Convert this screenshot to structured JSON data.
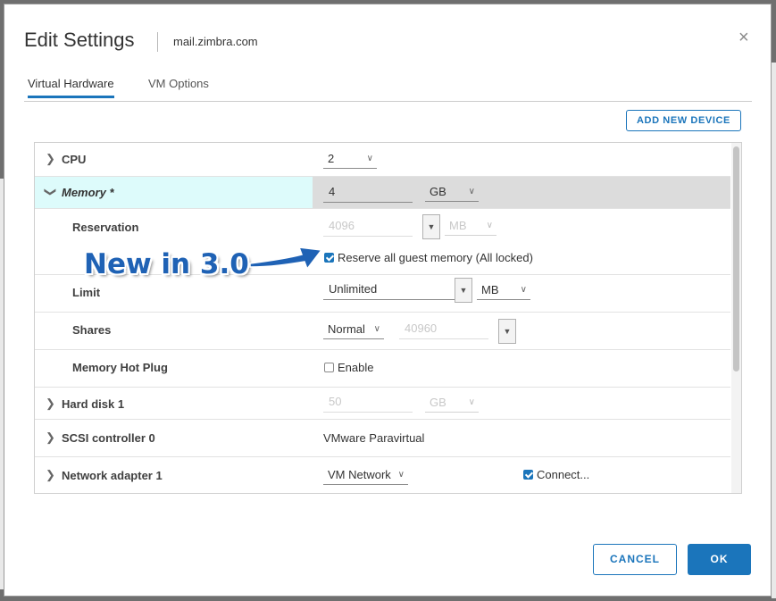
{
  "dialog": {
    "title": "Edit Settings",
    "subtitle": "mail.zimbra.com",
    "close_icon": "×"
  },
  "tabs": [
    {
      "label": "Virtual Hardware",
      "active": true
    },
    {
      "label": "VM Options",
      "active": false
    }
  ],
  "add_device_label": "ADD NEW DEVICE",
  "hardware": {
    "cpu": {
      "label": "CPU",
      "value": "2"
    },
    "memory": {
      "label": "Memory *",
      "value": "4",
      "unit": "GB"
    },
    "reservation": {
      "label": "Reservation",
      "value": "4096",
      "unit": "MB"
    },
    "reserve_all": {
      "label": "Reserve all guest memory (All locked)",
      "checked": true
    },
    "limit": {
      "label": "Limit",
      "value": "Unlimited",
      "unit": "MB"
    },
    "shares": {
      "label": "Shares",
      "level": "Normal",
      "value": "40960"
    },
    "hot_plug": {
      "label": "Memory Hot Plug",
      "option_label": "Enable",
      "checked": false
    },
    "hard_disk": {
      "label": "Hard disk 1",
      "value": "50",
      "unit": "GB"
    },
    "scsi": {
      "label": "SCSI controller 0",
      "value": "VMware Paravirtual"
    },
    "network": {
      "label": "Network adapter 1",
      "value": "VM Network",
      "connect_label": "Connect...",
      "connected": true
    }
  },
  "annotation": {
    "text": "New in 3.0"
  },
  "footer": {
    "cancel_label": "CANCEL",
    "ok_label": "OK"
  },
  "colors": {
    "accent": "#1b75bb",
    "highlight_row": "#ddfbfb",
    "annotation": "#1f62b5"
  },
  "icons": {
    "expand": "chevron-right-icon",
    "collapse": "chevron-down-icon",
    "dropdown": "caret-down-icon",
    "close": "close-icon"
  }
}
